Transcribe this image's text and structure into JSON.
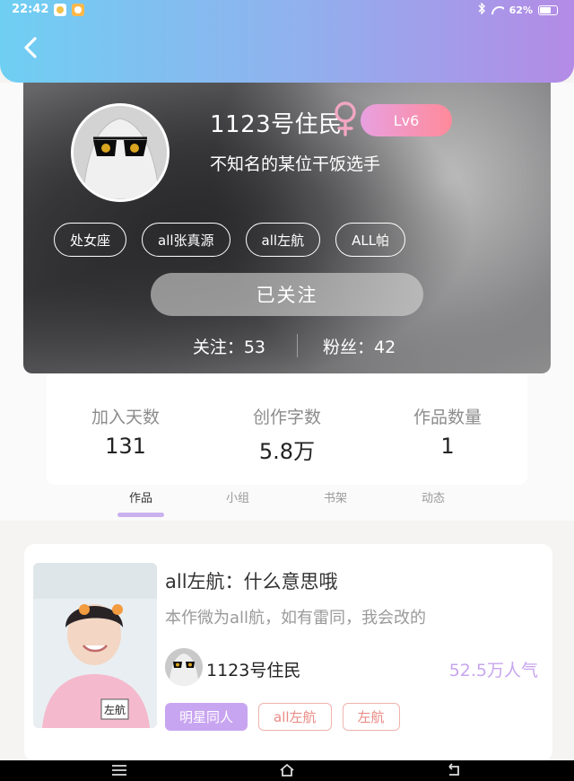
{
  "status_bar": {
    "time": "22:42",
    "battery_text": "62%",
    "battery_level": 0.62,
    "icons": [
      "app-notification-icon",
      "app-notification-icon",
      "bluetooth-icon",
      "wifi-icon",
      "battery-icon"
    ]
  },
  "header": {
    "back_icon": "chevron-left-icon"
  },
  "profile": {
    "nickname": "1123号住民",
    "gender_icon": "female-icon",
    "gender_symbol": "♀",
    "level": "Lv6",
    "signature": "不知名的某位干饭选手",
    "tags": [
      "处女座",
      "all张真源",
      "all左航",
      "ALL帕"
    ],
    "follow_button": "已关注",
    "following_text": "关注：53",
    "fans_text": "粉丝：42"
  },
  "info": {
    "items": [
      {
        "label": "加入天数",
        "value": "131"
      },
      {
        "label": "创作字数",
        "value": "5.8万"
      },
      {
        "label": "作品数量",
        "value": "1"
      }
    ]
  },
  "tabs": [
    "作品",
    "小组",
    "书架",
    "动态"
  ],
  "active_tab": "作品",
  "work": {
    "title": "all左航：什么意思哦",
    "summary": "本作微为all航，如有雷同，我会改的",
    "author": "1123号住民",
    "popularity": "52.5万人气",
    "cover_badge": "左航",
    "tags": [
      "明星同人",
      "all左航",
      "左航"
    ]
  },
  "colors": {
    "header_gradient_start": "#6fcff3",
    "header_gradient_end": "#b38be6",
    "level_badge_start": "#e8a0e0",
    "level_badge_end": "#ff8a9a",
    "accent_purple": "#c8a5f0",
    "tag_outline": "#f0b3ae",
    "popularity": "#c7a6ee"
  }
}
